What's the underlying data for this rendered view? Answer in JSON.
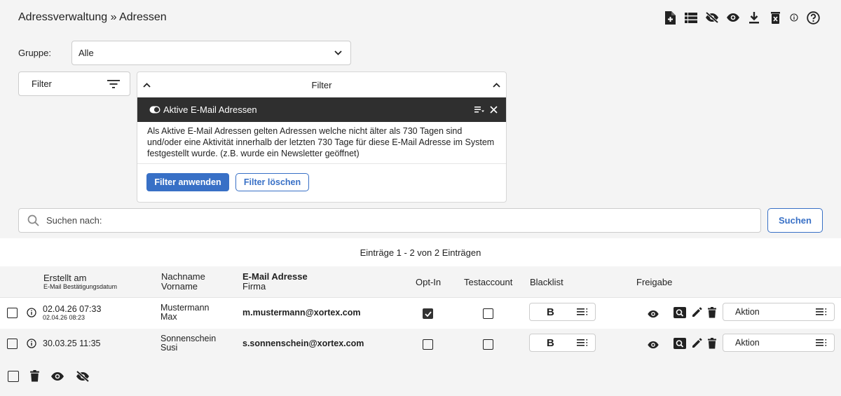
{
  "header": {
    "title": "Adressverwaltung » Adressen"
  },
  "top_icons": [
    "add-file-icon",
    "list-icon",
    "eye-off-icon",
    "eye-icon",
    "download-icon",
    "delete-box-icon",
    "info-icon",
    "help-icon"
  ],
  "group": {
    "label": "Gruppe:",
    "selected": "Alle"
  },
  "filter_button": {
    "label": "Filter"
  },
  "filter_panel": {
    "title": "Filter",
    "active_filter": "Aktive E-Mail Adressen",
    "description": "Als Aktive E-Mail Adressen gelten Adressen welche nicht älter als 730 Tagen sind und/oder eine Aktivität innerhalb der letzten 730 Tage für diese E-Mail Adresse im System festgestellt wurde. (z.B. wurde ein Newsletter geöffnet)",
    "apply_label": "Filter anwenden",
    "clear_label": "Filter löschen"
  },
  "search": {
    "placeholder": "Suchen nach:",
    "button_label": "Suchen"
  },
  "entries_info": "Einträge 1 - 2 von 2 Einträgen",
  "table": {
    "headers": {
      "created": "Erstellt am",
      "created_sub": "E-Mail Bestätigungsdatum",
      "lastname": "Nachname",
      "firstname": "Vorname",
      "email": "E-Mail Adresse",
      "company": "Firma",
      "optin": "Opt-In",
      "testaccount": "Testaccount",
      "blacklist": "Blacklist",
      "release": "Freigabe"
    },
    "rows": [
      {
        "created": "02.04.26 07:33",
        "confirmed": "02.04.26 08:23",
        "lastname": "Mustermann",
        "firstname": "Max",
        "email": "m.mustermann@xortex.com",
        "optin": true,
        "testaccount": false,
        "blacklist_label": "B",
        "action_label": "Aktion"
      },
      {
        "created": "30.03.25 11:35",
        "confirmed": "",
        "lastname": "Sonnenschein",
        "firstname": "Susi",
        "email": "s.sonnenschein@xortex.com",
        "optin": false,
        "testaccount": false,
        "blacklist_label": "B",
        "action_label": "Aktion"
      }
    ]
  },
  "colors": {
    "accent": "#3870c6",
    "dark_bar": "#2f2f2f",
    "background": "#f4f4f4"
  }
}
